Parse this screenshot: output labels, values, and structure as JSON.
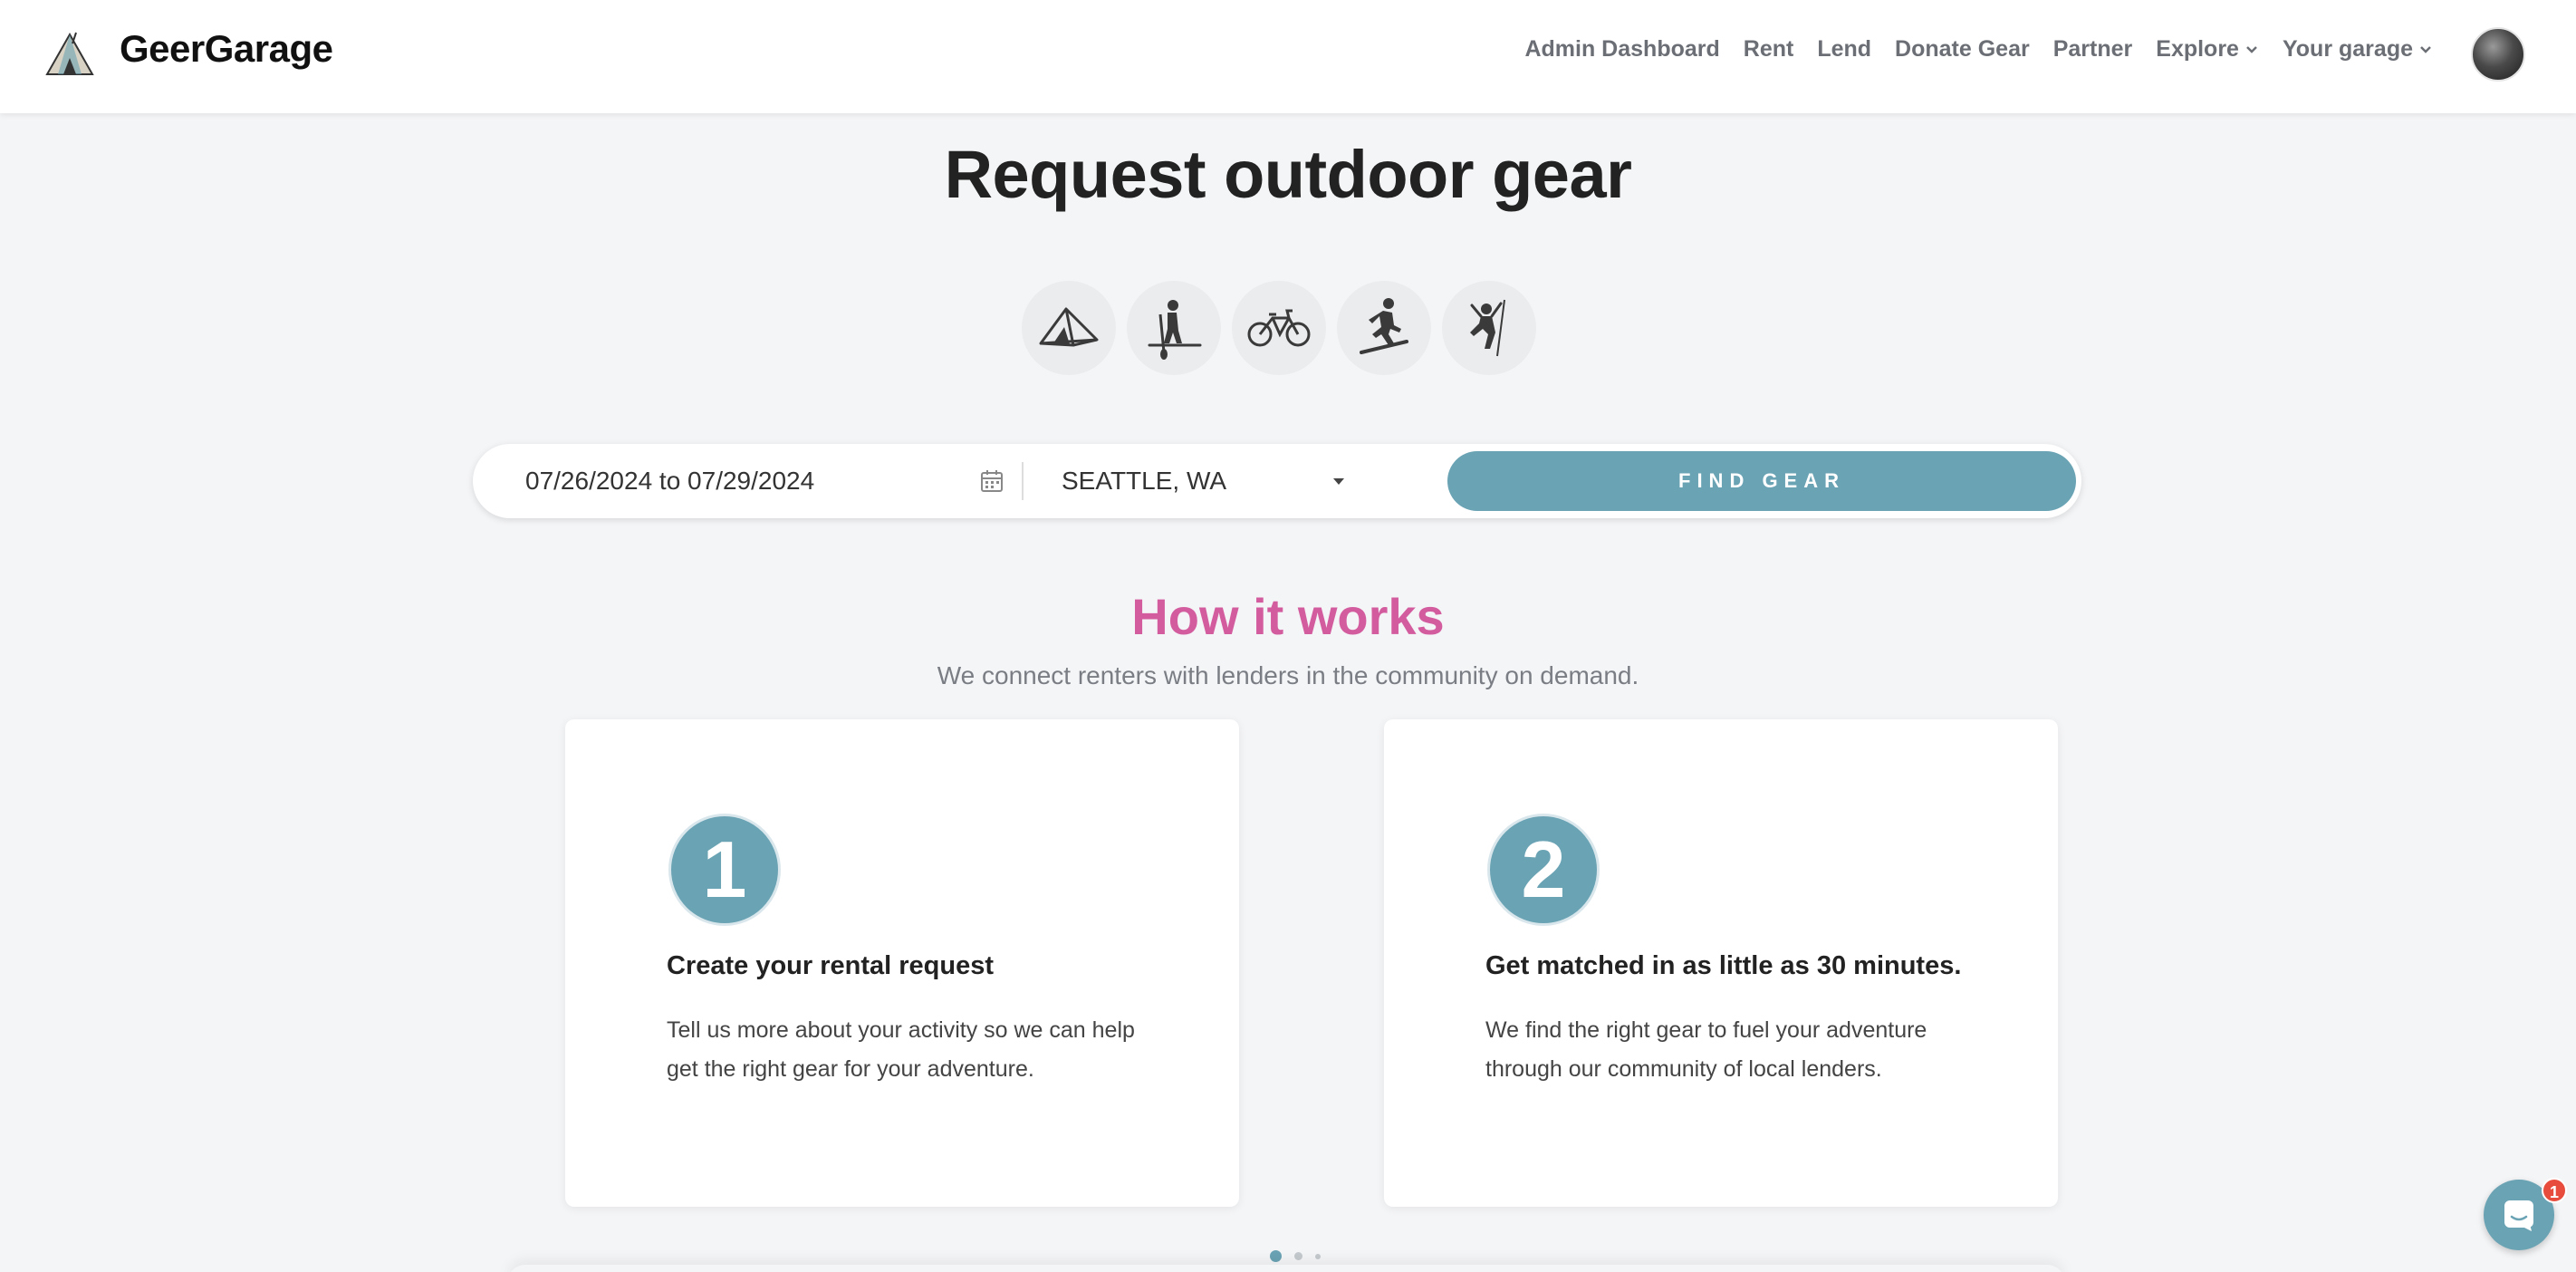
{
  "header": {
    "brand": "GeerGarage",
    "logo_icon": "mountain-tent-logo-icon",
    "nav": [
      {
        "label": "Admin Dashboard",
        "dropdown": false
      },
      {
        "label": "Rent",
        "dropdown": false
      },
      {
        "label": "Lend",
        "dropdown": false
      },
      {
        "label": "Donate Gear",
        "dropdown": false
      },
      {
        "label": "Partner",
        "dropdown": false
      },
      {
        "label": "Explore",
        "dropdown": true
      },
      {
        "label": "Your garage",
        "dropdown": true
      }
    ],
    "avatar_icon": "user-avatar"
  },
  "hero": {
    "title": "Request outdoor gear",
    "activities": [
      {
        "icon": "tent-icon"
      },
      {
        "icon": "paddleboard-icon"
      },
      {
        "icon": "bicycle-icon"
      },
      {
        "icon": "snowboard-icon"
      },
      {
        "icon": "climbing-icon"
      }
    ]
  },
  "search": {
    "date_range": "07/26/2024 to 07/29/2024",
    "calendar_icon": "calendar-icon",
    "location": "SEATTLE, WA",
    "location_caret_icon": "caret-down-icon",
    "button_label": "FIND GEAR"
  },
  "how_it_works": {
    "title": "How it works",
    "subtitle": "We connect renters with lenders in the community on demand.",
    "steps": [
      {
        "number": "1",
        "title": "Create your rental request",
        "description": "Tell us more about your activity so we can help get the right gear for your adventure."
      },
      {
        "number": "2",
        "title": "Get matched in as little as 30 minutes.",
        "description": "We find the right gear to fuel your adventure through our community of local lenders."
      }
    ],
    "carousel": {
      "pages": 3,
      "active_index": 0
    }
  },
  "chat": {
    "icon": "chat-icon",
    "badge_count": "1"
  },
  "colors": {
    "accent": "#6aa3b4",
    "heading_pink": "#d35c9f",
    "page_bg": "#f4f5f7",
    "badge_red": "#e74c3c"
  }
}
